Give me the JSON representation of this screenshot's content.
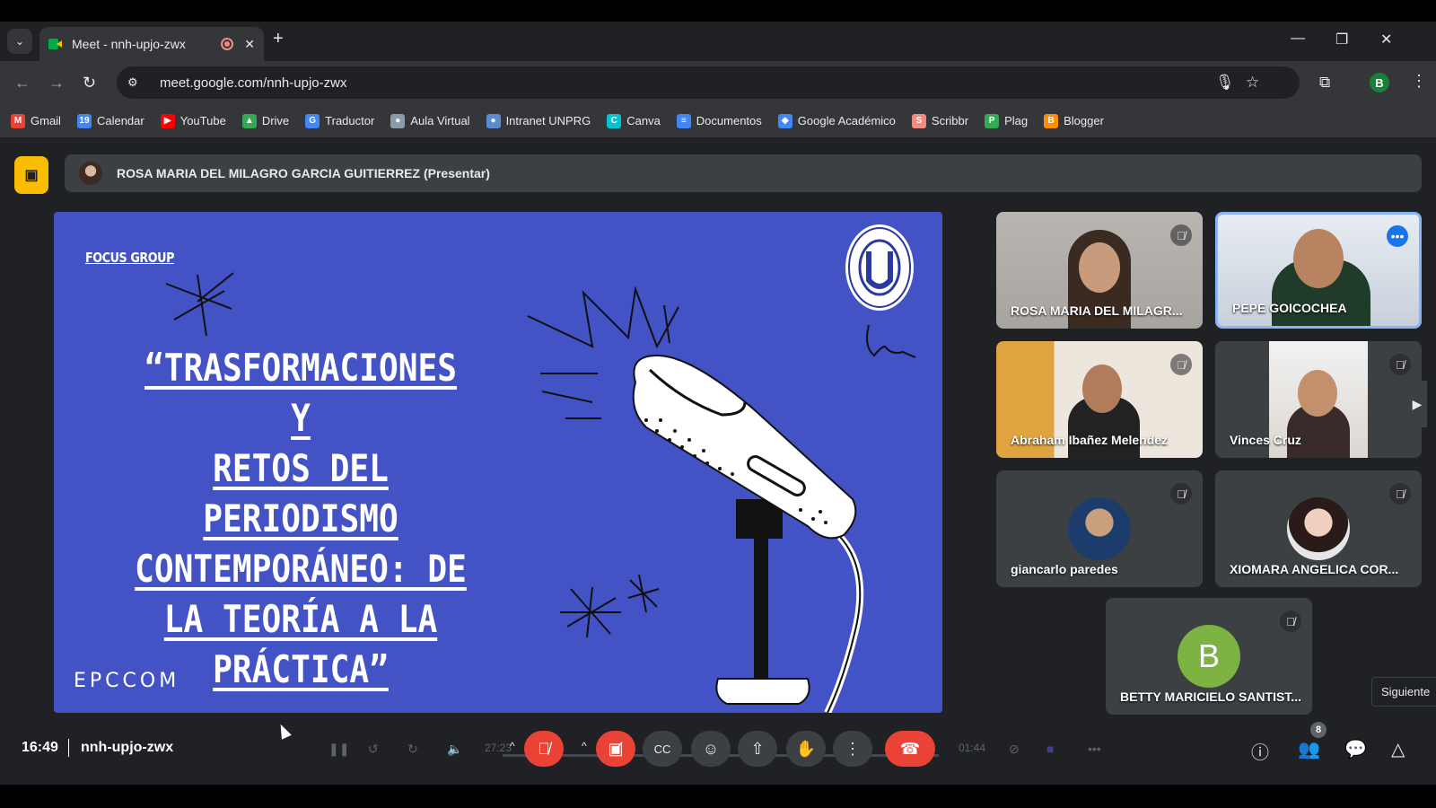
{
  "browser": {
    "tab_title": "Meet - nnh-upjo-zwx",
    "url": "meet.google.com/nnh-upjo-zwx",
    "profile_initial": "B"
  },
  "bookmarks": [
    {
      "label": "Gmail",
      "icon": "gmail-icon",
      "color": "#ea4335",
      "glyph": "M"
    },
    {
      "label": "Calendar",
      "icon": "calendar-icon",
      "color": "#4285f4",
      "glyph": "19"
    },
    {
      "label": "YouTube",
      "icon": "youtube-icon",
      "color": "#ff0000",
      "glyph": "▶"
    },
    {
      "label": "Drive",
      "icon": "drive-icon",
      "color": "#34a853",
      "glyph": "▲"
    },
    {
      "label": "Traductor",
      "icon": "translate-icon",
      "color": "#4285f4",
      "glyph": "G"
    },
    {
      "label": "Aula Virtual",
      "icon": "moodle-icon",
      "color": "#8a9aa8",
      "glyph": "●"
    },
    {
      "label": "Intranet UNPRG",
      "icon": "intranet-icon",
      "color": "#5b8bd0",
      "glyph": "●"
    },
    {
      "label": "Canva",
      "icon": "canva-icon",
      "color": "#00c4cc",
      "glyph": "C"
    },
    {
      "label": "Documentos",
      "icon": "docs-icon",
      "color": "#4285f4",
      "glyph": "≡"
    },
    {
      "label": "Google Académico",
      "icon": "scholar-icon",
      "color": "#4285f4",
      "glyph": "◆"
    },
    {
      "label": "Scribbr",
      "icon": "scribbr-icon",
      "color": "#f28b82",
      "glyph": "S"
    },
    {
      "label": "Plag",
      "icon": "plag-icon",
      "color": "#34a853",
      "glyph": "P"
    },
    {
      "label": "Blogger",
      "icon": "blogger-icon",
      "color": "#ff8f00",
      "glyph": "B"
    }
  ],
  "presenter_bar": {
    "text": "ROSA MARIA DEL MILAGRO GARCIA GUITIERREZ (Presentar)"
  },
  "slide": {
    "tag": "FOCUS GROUP",
    "title_lines": [
      "“TRASFORMACIONES Y",
      "RETOS DEL",
      "PERIODISMO",
      "CONTEMPORÁNEO: DE",
      "LA TEORÍA A LA",
      "PRÁCTICA”"
    ],
    "footer": "EPCCOM"
  },
  "participants": [
    {
      "name": "ROSA MARIA DEL MILAGR...",
      "muted": true
    },
    {
      "name": "PEPE GOICOCHEA",
      "muted": false,
      "active": true
    },
    {
      "name": "Abraham Ibañez Melendez",
      "muted": true
    },
    {
      "name": "Vinces Cruz",
      "muted": true
    },
    {
      "name": "giancarlo paredes",
      "muted": true
    },
    {
      "name": "XIOMARA ANGELICA COR...",
      "muted": true
    },
    {
      "name": "BETTY MARICIELO SANTIST...",
      "muted": true,
      "initial": "B",
      "avatar_color": "#7cb342"
    }
  ],
  "tooltip": "Siguiente",
  "bottom": {
    "time": "16:49",
    "meeting_code": "nnh-upjo-zwx",
    "media_elapsed": "27:23",
    "media_remaining": "01:44",
    "people_count": "8"
  }
}
